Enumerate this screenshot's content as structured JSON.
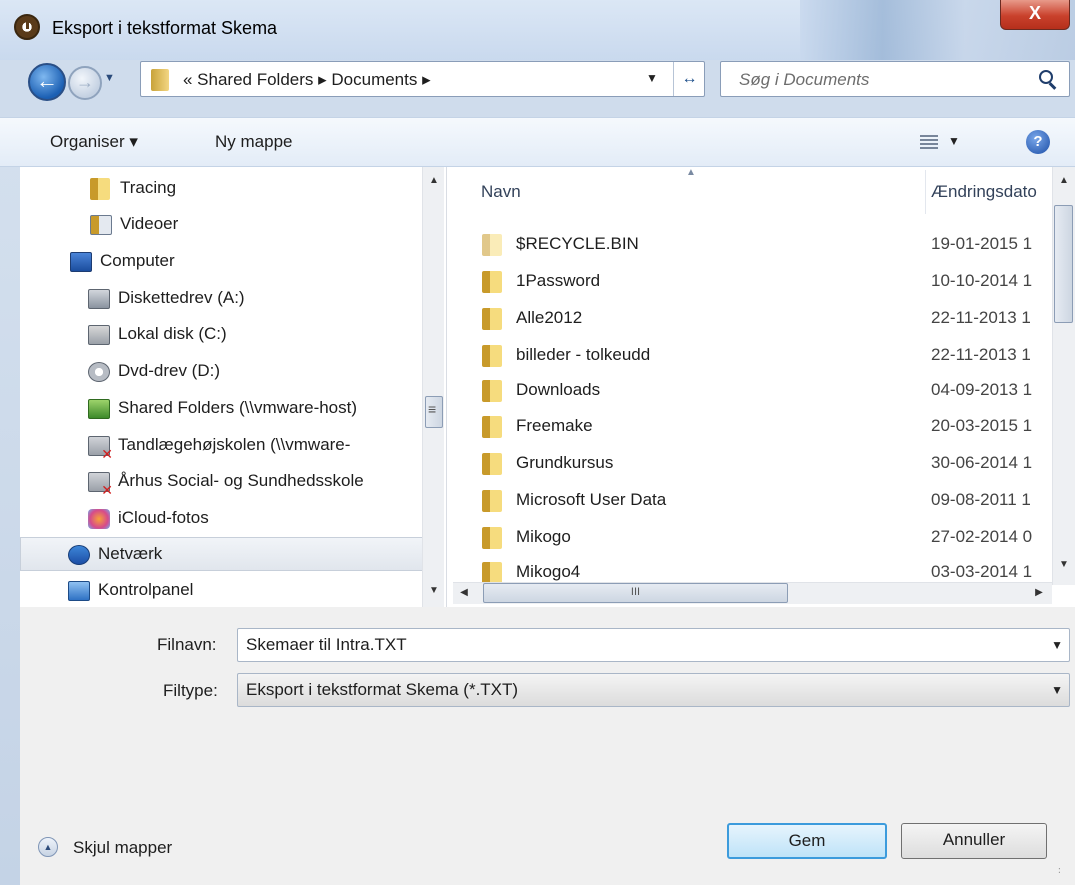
{
  "window": {
    "title": "Eksport i tekstformat Skema",
    "close_glyph": "X"
  },
  "address": {
    "path": "« Shared Folders ▸ Documents ▸",
    "search_placeholder": "Søg i Documents"
  },
  "toolbar": {
    "organise": "Organiser ▾",
    "new_folder": "Ny mappe",
    "help": "?"
  },
  "tree": [
    {
      "label": "Tracing",
      "icon": "folder-icon"
    },
    {
      "label": "Videoer",
      "icon": "video-folder-icon"
    },
    {
      "label": "Computer",
      "icon": "computer-icon"
    },
    {
      "label": "Diskettedrev (A:)",
      "icon": "floppy-drive-icon"
    },
    {
      "label": "Lokal disk (C:)",
      "icon": "local-disk-icon"
    },
    {
      "label": "Dvd-drev (D:)",
      "icon": "dvd-drive-icon"
    },
    {
      "label": "Shared Folders (\\\\vmware-host)",
      "icon": "network-drive-icon"
    },
    {
      "label": "Tandlægehøjskolen (\\\\vmware-",
      "icon": "disconnected-drive-icon"
    },
    {
      "label": "Århus Social- og Sundhedsskole",
      "icon": "disconnected-drive-icon"
    },
    {
      "label": "iCloud-fotos",
      "icon": "icloud-photos-icon"
    },
    {
      "label": "Netværk",
      "icon": "network-icon"
    },
    {
      "label": "Kontrolpanel",
      "icon": "control-panel-icon"
    }
  ],
  "columns": {
    "name": "Navn",
    "date": "Ændringsdato"
  },
  "files": [
    {
      "name": "$RECYCLE.BIN",
      "date": "19-01-2015 1"
    },
    {
      "name": "1Password",
      "date": "10-10-2014 1"
    },
    {
      "name": "Alle2012",
      "date": "22-11-2013 1"
    },
    {
      "name": "billeder - tolkeudd",
      "date": "22-11-2013 1"
    },
    {
      "name": "Downloads",
      "date": "04-09-2013 1"
    },
    {
      "name": "Freemake",
      "date": "20-03-2015 1"
    },
    {
      "name": "Grundkursus",
      "date": "30-06-2014 1"
    },
    {
      "name": "Microsoft User Data",
      "date": "09-08-2011 1"
    },
    {
      "name": "Mikogo",
      "date": "27-02-2014 0"
    },
    {
      "name": "Mikogo4",
      "date": "03-03-2014 1"
    }
  ],
  "form": {
    "filename_label": "Filnavn:",
    "filename_value": "Skemaer til Intra.TXT",
    "filetype_label": "Filtype:",
    "filetype_value": "Eksport i tekstformat Skema (*.TXT)"
  },
  "footer": {
    "hide_folders": "Skjul mapper",
    "save": "Gem",
    "cancel": "Annuller"
  },
  "scroll": {
    "hthumb_glyph": "III"
  }
}
